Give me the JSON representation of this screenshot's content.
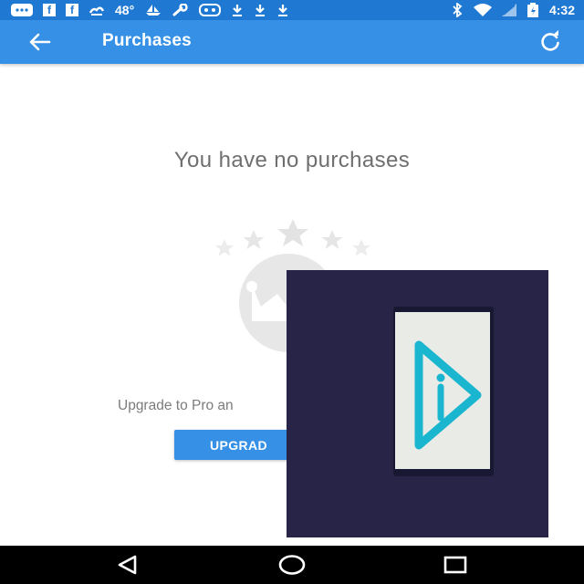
{
  "status_bar": {
    "temperature": "48°",
    "time": "4:32",
    "icons": [
      "message-icon",
      "facebook-icon",
      "facebook-icon",
      "weather-icon",
      "boat-icon",
      "wrench-icon",
      "game-icon",
      "download-icon",
      "download-icon",
      "download-icon",
      "bluetooth-icon",
      "wifi-icon",
      "signal-icon",
      "battery-icon"
    ]
  },
  "app_bar": {
    "title": "Purchases",
    "back_icon": "arrow-left-icon",
    "refresh_icon": "refresh-icon"
  },
  "main": {
    "empty_title": "You have no purchases",
    "upgrade_text": "Upgrade to Pro an",
    "upgrade_button_label": "UPGRAD",
    "illustration_icon": "crown-stars-icon"
  },
  "nav_bar": {
    "icons": [
      "back-triangle-icon",
      "home-circle-icon",
      "recents-square-icon"
    ]
  },
  "colors": {
    "status_bar": "#1f78d2",
    "app_bar": "#3590e6",
    "overlay_bg": "#272448",
    "logo_accent": "#1ab5cf"
  }
}
